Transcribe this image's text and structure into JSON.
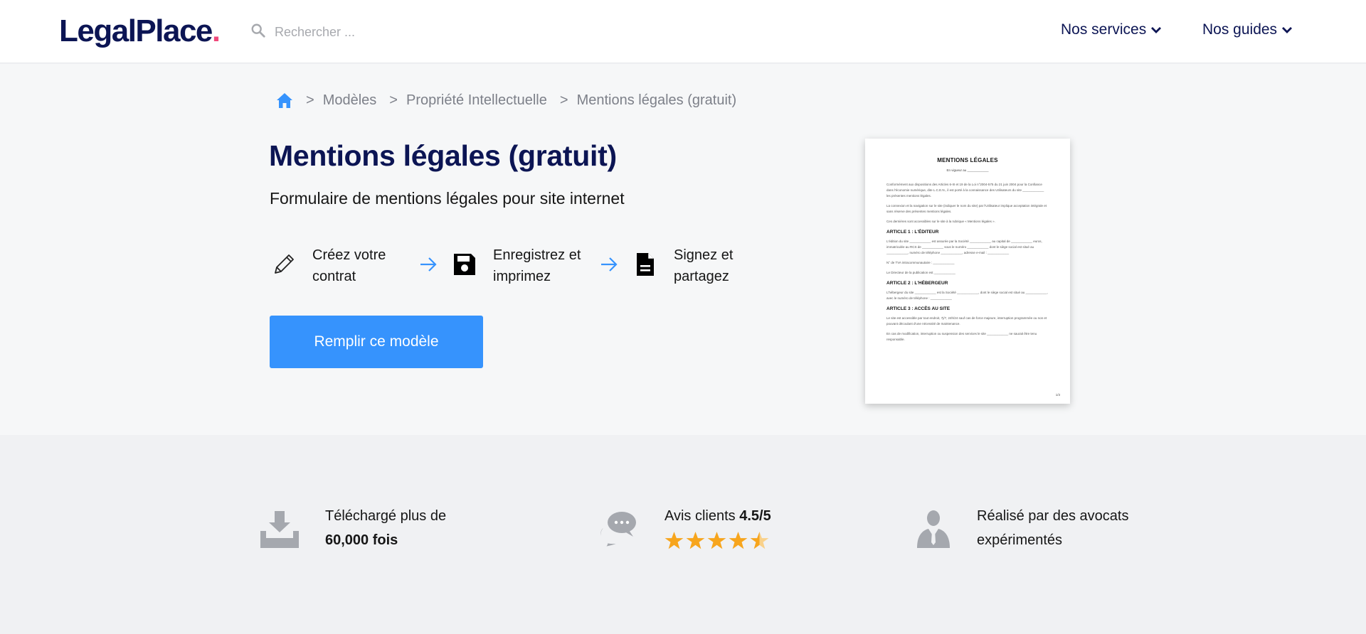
{
  "header": {
    "logo_text": "LegalPlace",
    "logo_dot": ".",
    "search_placeholder": "Rechercher ...",
    "nav": [
      {
        "label": "Nos services"
      },
      {
        "label": "Nos guides"
      }
    ]
  },
  "breadcrumb": {
    "items": [
      "Modèles",
      "Propriété Intellectuelle",
      "Mentions légales (gratuit)"
    ],
    "separator": ">"
  },
  "hero": {
    "title": "Mentions légales (gratuit)",
    "subtitle": "Formulaire de mentions légales pour site internet",
    "steps": [
      {
        "icon": "pencil-icon",
        "label": "Créez votre contrat"
      },
      {
        "icon": "floppy-disk-icon",
        "label": "Enregistrez et imprimez"
      },
      {
        "icon": "document-icon",
        "label": "Signez et partagez"
      }
    ],
    "cta_label": "Remplir ce modèle"
  },
  "document_preview": {
    "title": "MENTIONS LÉGALES",
    "subtitle": "En vigueur au ____________",
    "paragraphs": [
      "Conformément aux dispositions des Articles 6-III et 19 de la Loi n°2004-575 du 21 juin 2004 pour la Confiance dans l'économie numérique, dite L.C.E.N., il est porté à la connaissance des Utilisateurs du site ____________ les présentes mentions légales.",
      "La connexion et la navigation sur le site (indiquer le nom du site) par l'Utilisateur implique acceptation intégrale et sans réserve des présentes mentions légales.",
      "Ces dernières sont accessibles sur le site à la rubrique « Mentions légales »."
    ],
    "article1_title": "ARTICLE 1 : L'ÉDITEUR",
    "article1_text": "L'édition du site ____________ est assurée par la Société ____________ au capital de ____________ euros, immatriculée au RCS de ____________ sous le numéro ____________ dont le siège social est situé au ____________, numéro de téléphone ____________, adresse e-mail : ____________",
    "article1_tva": "N° de TVA intracommunautaire : ____________",
    "article1_director": "Le Directeur de la publication est ____________",
    "article2_title": "ARTICLE 2 : L'HÉBERGEUR",
    "article2_text": "L'hébergeur du site ____________ est la Société ____________, dont le siège social est situé au ____________, avec le numéro de téléphone : ____________",
    "article3_title": "ARTICLE 3 : ACCÈS AU SITE",
    "article3_text1": "Le site est accessible par tout endroit, 7j/7, 24h/24 sauf cas de force majeure, interruption programmée ou non et pouvant découlant d'une nécessité de maintenance.",
    "article3_text2": "En cas de modification, interruption ou suspension des services le site ____________ ne saurait être tenu responsable.",
    "page_number": "1/3"
  },
  "stats": {
    "downloads_label": "Téléchargé plus de",
    "downloads_value": "60,000 fois",
    "reviews_label": "Avis clients",
    "reviews_value": "4.5/5",
    "rating": 4.5,
    "rating_max": 5,
    "lawyers_text": "Réalisé par des avocats expérimentés"
  },
  "colors": {
    "brand_navy": "#0c1554",
    "accent_blue": "#3693fd",
    "logo_dot": "#f0487a",
    "star": "#f7a51d"
  }
}
